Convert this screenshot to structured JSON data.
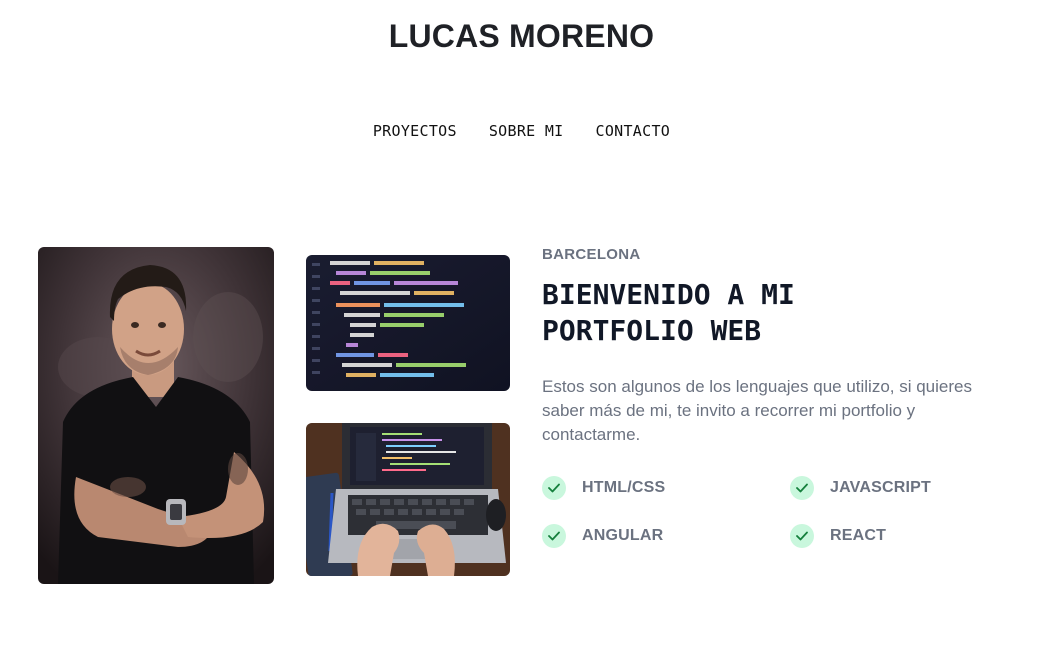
{
  "header": {
    "title": "LUCAS MORENO"
  },
  "nav": {
    "items": [
      {
        "label": "PROYECTOS"
      },
      {
        "label": "SOBRE MI"
      },
      {
        "label": "CONTACTO"
      }
    ]
  },
  "hero": {
    "location": "BARCELONA",
    "headline": "BIENVENIDO A MI PORTFOLIO WEB",
    "intro": "Estos son algunos de los lenguajes que utilizo, si quieres saber más de mi, te invito a recorrer mi portfolio y contactarme.",
    "skills": [
      {
        "label": "HTML/CSS",
        "icon": "check-icon"
      },
      {
        "label": "JAVASCRIPT",
        "icon": "check-icon"
      },
      {
        "label": "ANGULAR",
        "icon": "check-icon"
      },
      {
        "label": "REACT",
        "icon": "check-icon"
      }
    ]
  },
  "images": {
    "portrait": "portrait-photo",
    "code": "code-screen-photo",
    "laptop": "laptop-typing-photo"
  },
  "colors": {
    "title": "#1f2126",
    "muted": "#6b7280",
    "check_bg": "#c9f7dd",
    "check_mark": "#15803d"
  }
}
